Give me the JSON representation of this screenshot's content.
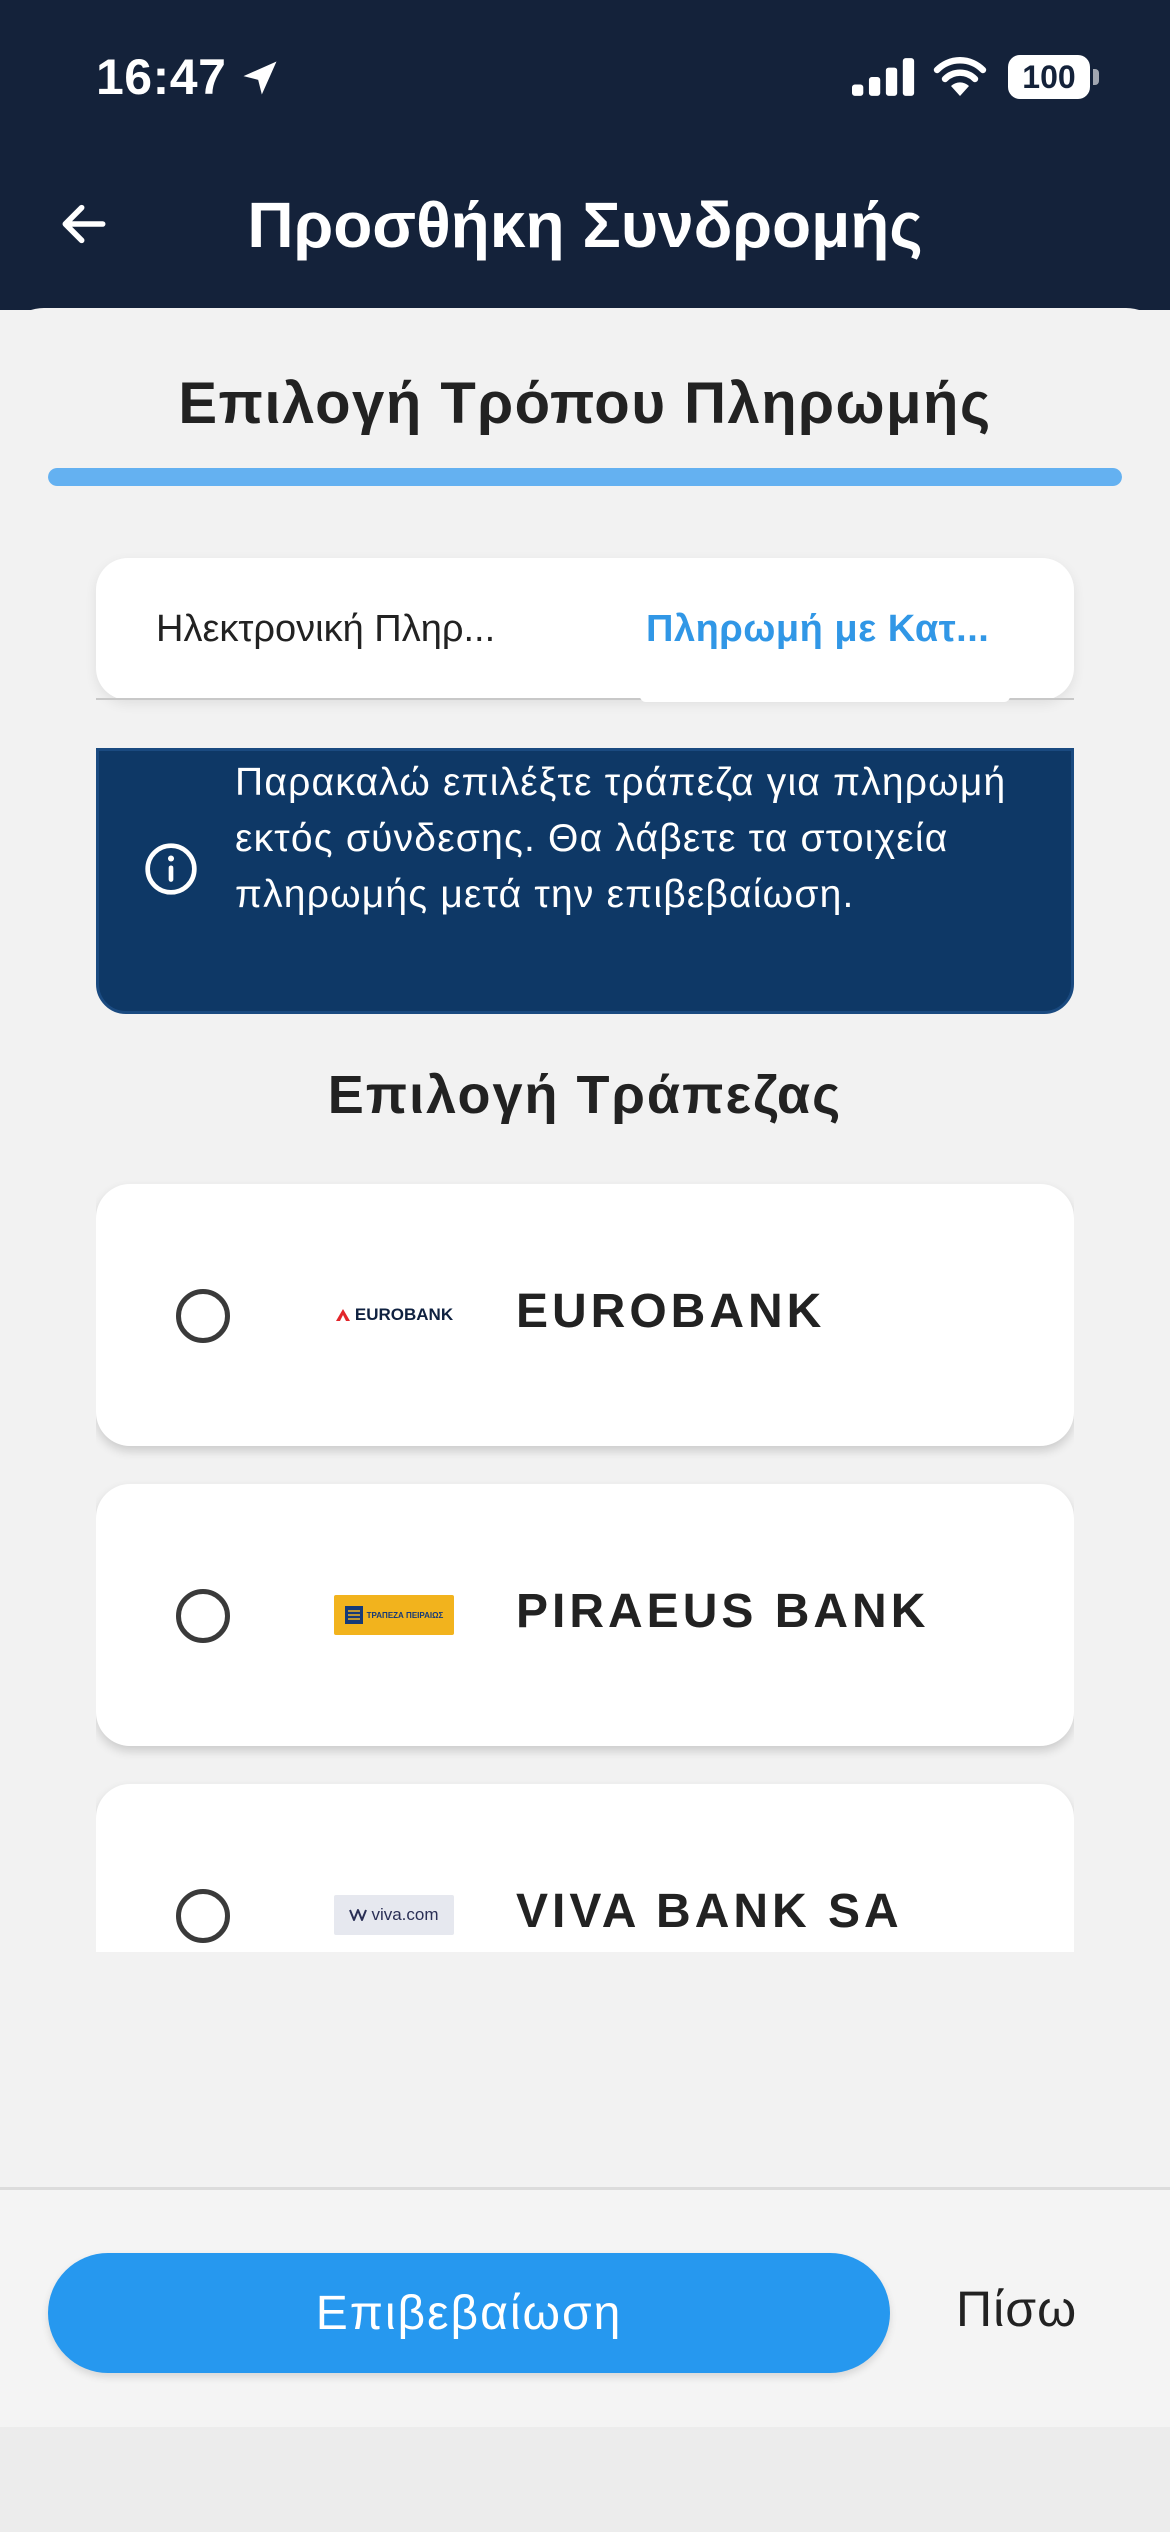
{
  "status_bar": {
    "time": "16:47",
    "battery": "100"
  },
  "header": {
    "title": "Προσθήκη Συνδρομής",
    "back_icon": "arrow-left-icon"
  },
  "step": {
    "title": "Επιλογή Τρόπου Πληρωμής",
    "progress_fraction": 1.0
  },
  "tabs": [
    {
      "label": "Ηλεκτρονική Πληρ...",
      "active": false
    },
    {
      "label": "Πληρωμή με Κατ...",
      "active": true
    }
  ],
  "info": {
    "icon": "info-icon",
    "text": "Παρακαλώ επιλέξτε τράπεζα για πληρωμή εκτός σύνδεσης. Θα λάβετε τα στοιχεία πληρωμής μετά την επιβεβαίωση."
  },
  "banks": {
    "title": "Επιλογή Τράπεζας",
    "items": [
      {
        "name": "EUROBANK",
        "logo_text": "EUROBANK",
        "selected": false
      },
      {
        "name": "PIRAEUS BANK",
        "logo_text": "ΤΡΑΠΕΖΑ ΠΕΙΡΑΙΩΣ",
        "selected": false
      },
      {
        "name": "VIVA BANK SA",
        "logo_text": "viva.com",
        "selected": false
      }
    ]
  },
  "actions": {
    "confirm": "Επιβεβαίωση",
    "back": "Πίσω"
  },
  "colors": {
    "header_bg": "#14223a",
    "accent": "#2698ef",
    "info_bg": "#0e3866"
  }
}
